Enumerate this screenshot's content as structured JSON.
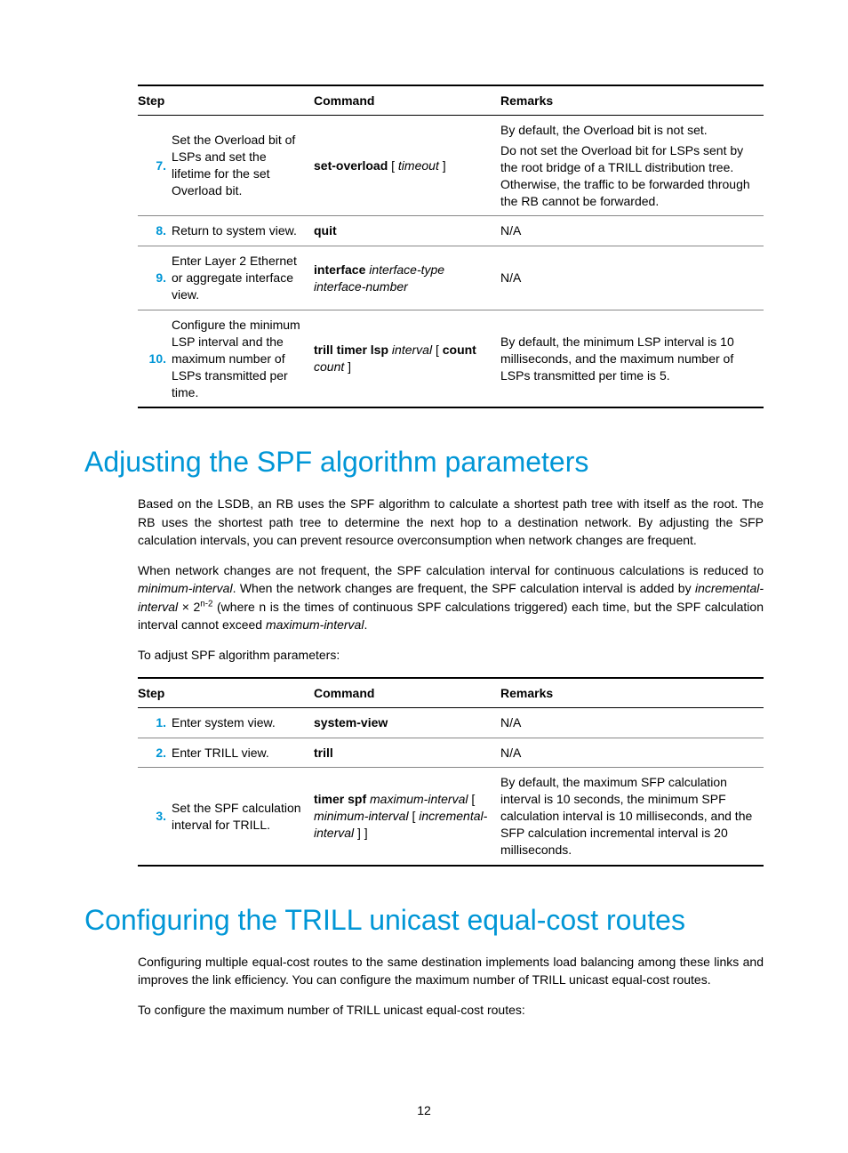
{
  "pageNumber": "12",
  "table1": {
    "header": {
      "step": "Step",
      "command": "Command",
      "remarks": "Remarks"
    },
    "rows": [
      {
        "num": "7.",
        "desc": "Set the Overload bit of LSPs and set the lifetime for the set Overload bit.",
        "cmd_parts": [
          {
            "t": "set-overload",
            "s": "b"
          },
          {
            "t": " [ ",
            "s": ""
          },
          {
            "t": "timeout",
            "s": "i"
          },
          {
            "t": " ]",
            "s": ""
          }
        ],
        "remarks_lines": [
          "By default, the Overload bit is not set.",
          "Do not set the Overload bit for LSPs sent by the root bridge of a TRILL distribution tree. Otherwise, the traffic to be forwarded through the RB cannot be forwarded."
        ]
      },
      {
        "num": "8.",
        "desc": "Return to system view.",
        "cmd_parts": [
          {
            "t": "quit",
            "s": "b"
          }
        ],
        "remarks_lines": [
          "N/A"
        ]
      },
      {
        "num": "9.",
        "desc": "Enter Layer 2 Ethernet or aggregate interface view.",
        "cmd_parts": [
          {
            "t": "interface",
            "s": "b"
          },
          {
            "t": " interface-type interface-number",
            "s": "i"
          }
        ],
        "remarks_lines": [
          "N/A"
        ]
      },
      {
        "num": "10.",
        "desc": "Configure the minimum LSP interval and the maximum number of LSPs transmitted per time.",
        "cmd_parts": [
          {
            "t": "trill timer lsp",
            "s": "b"
          },
          {
            "t": " interval",
            "s": "i"
          },
          {
            "t": " [ ",
            "s": ""
          },
          {
            "t": "count",
            "s": "b"
          },
          {
            "t": " ",
            "s": ""
          },
          {
            "t": "count",
            "s": "i"
          },
          {
            "t": " ]",
            "s": ""
          }
        ],
        "remarks_lines": [
          "By default, the minimum LSP interval is 10 milliseconds, and the maximum number of LSPs transmitted per time is 5."
        ]
      }
    ]
  },
  "h1a": "Adjusting the SPF algorithm parameters",
  "p1": "Based on the LSDB, an RB uses the SPF algorithm to calculate a shortest path tree with itself as the root. The RB uses the shortest path tree to determine the next hop to a destination network. By adjusting the SFP calculation intervals, you can prevent resource overconsumption when network changes are frequent.",
  "p2_pre": "When network changes are not frequent, the SPF calculation interval for continuous calculations is reduced to ",
  "p2_i1": "minimum-interval",
  "p2_mid1": ". When the network changes are frequent, the SPF calculation interval is added by ",
  "p2_i2": "incremental-interval",
  "p2_times": " × 2",
  "p2_sup": "n-2",
  "p2_mid2": " (where n is the times of continuous SPF calculations triggered) each time, but the SPF calculation interval cannot exceed ",
  "p2_i3": "maximum-interval",
  "p2_end": ".",
  "p3": "To adjust SPF algorithm parameters:",
  "table2": {
    "header": {
      "step": "Step",
      "command": "Command",
      "remarks": "Remarks"
    },
    "rows": [
      {
        "num": "1.",
        "desc": "Enter system view.",
        "cmd_parts": [
          {
            "t": "system-view",
            "s": "b"
          }
        ],
        "remarks_lines": [
          "N/A"
        ]
      },
      {
        "num": "2.",
        "desc": "Enter TRILL view.",
        "cmd_parts": [
          {
            "t": "trill",
            "s": "b"
          }
        ],
        "remarks_lines": [
          "N/A"
        ]
      },
      {
        "num": "3.",
        "desc": "Set the SPF calculation interval for TRILL.",
        "cmd_parts": [
          {
            "t": "timer spf",
            "s": "b"
          },
          {
            "t": " maximum-interval",
            "s": "i"
          },
          {
            "t": " [ ",
            "s": ""
          },
          {
            "t": "minimum-interval",
            "s": "i"
          },
          {
            "t": " [ ",
            "s": ""
          },
          {
            "t": "incremental-interval",
            "s": "i"
          },
          {
            "t": " ] ]",
            "s": ""
          }
        ],
        "remarks_lines": [
          "By default, the maximum SFP calculation interval is 10 seconds, the minimum SPF calculation interval is 10 milliseconds, and the SFP calculation incremental interval is 20 milliseconds."
        ]
      }
    ]
  },
  "h1b": "Configuring the TRILL unicast equal-cost routes",
  "p4": "Configuring multiple equal-cost routes to the same destination implements load balancing among these links and improves the link efficiency. You can configure the maximum number of TRILL unicast equal-cost routes.",
  "p5": "To configure the maximum number of TRILL unicast equal-cost routes:"
}
